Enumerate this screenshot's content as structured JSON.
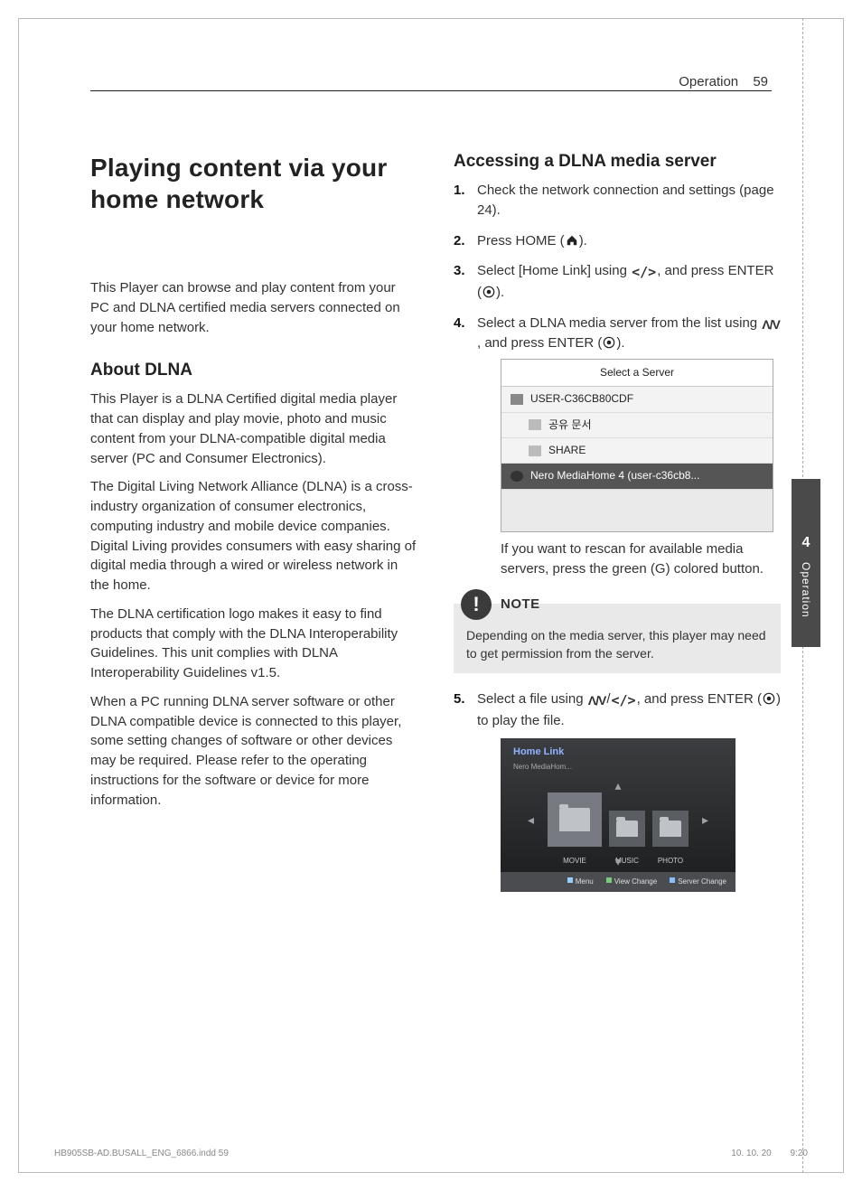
{
  "header": {
    "section": "Operation",
    "page": "59"
  },
  "title": "Playing content via your home network",
  "intro": "This Player can browse and play content from your PC and DLNA certified media servers connected on your home network.",
  "about_heading": "About DLNA",
  "about_p1": "This Player is a DLNA Certified digital media player that can display and play movie, photo and music content from your DLNA-compatible digital media server (PC and Consumer Electronics).",
  "about_p2": "The Digital Living Network Alliance (DLNA) is a cross-industry organization of consumer electronics, computing industry and mobile device companies. Digital Living provides consumers with easy sharing of digital media through a wired or wireless network in the home.",
  "about_p3": "The DLNA certification logo makes it easy to find products that comply with the DLNA Interoperability Guidelines. This unit complies with DLNA Interoperability Guidelines v1.5.",
  "about_p4": "When a PC running DLNA server software or other DLNA compatible device is connected to this player, some setting changes of software or other devices may be required. Please refer to the operating instructions for the software or device for more information.",
  "access_heading": "Accessing a DLNA media server",
  "steps": {
    "s1": "Check the network connection and settings (page 24).",
    "s2a": "Press HOME (",
    "s2b": ").",
    "s3a": "Select [Home Link] using ",
    "s3b": ", and press ENTER (",
    "s3c": ").",
    "s4a": "Select a DLNA media server from the list using ",
    "s4b": ", and press ENTER (",
    "s4c": ").",
    "s5a": "Select a file using ",
    "s5b": ", and press ENTER (",
    "s5c": ") to play the file."
  },
  "server_panel": {
    "title": "Select a Server",
    "row1": "USER-C36CB80CDF",
    "row2": "공유 문서",
    "row3": "SHARE",
    "row4": "Nero MediaHome 4 (user-c36cb8..."
  },
  "rescan": "If you want to rescan for available media servers, press the green (G) colored button.",
  "note": {
    "label": "NOTE",
    "text": "Depending on the media server, this player may need to get permission from the server."
  },
  "homelink": {
    "title": "Home Link",
    "sub": "Nero MediaHom...",
    "cards": {
      "movie": "MOVIE",
      "music": "MUSIC",
      "photo": "PHOTO"
    },
    "footer": {
      "menu": "Menu",
      "view": "View Change",
      "server": "Server Change"
    }
  },
  "sidetab": {
    "num": "4",
    "label": "Operation"
  },
  "print": {
    "file": "HB905SB-AD.BUSALL_ENG_6866.indd   59",
    "date": "10. 10. 20",
    "time": "9:20"
  }
}
